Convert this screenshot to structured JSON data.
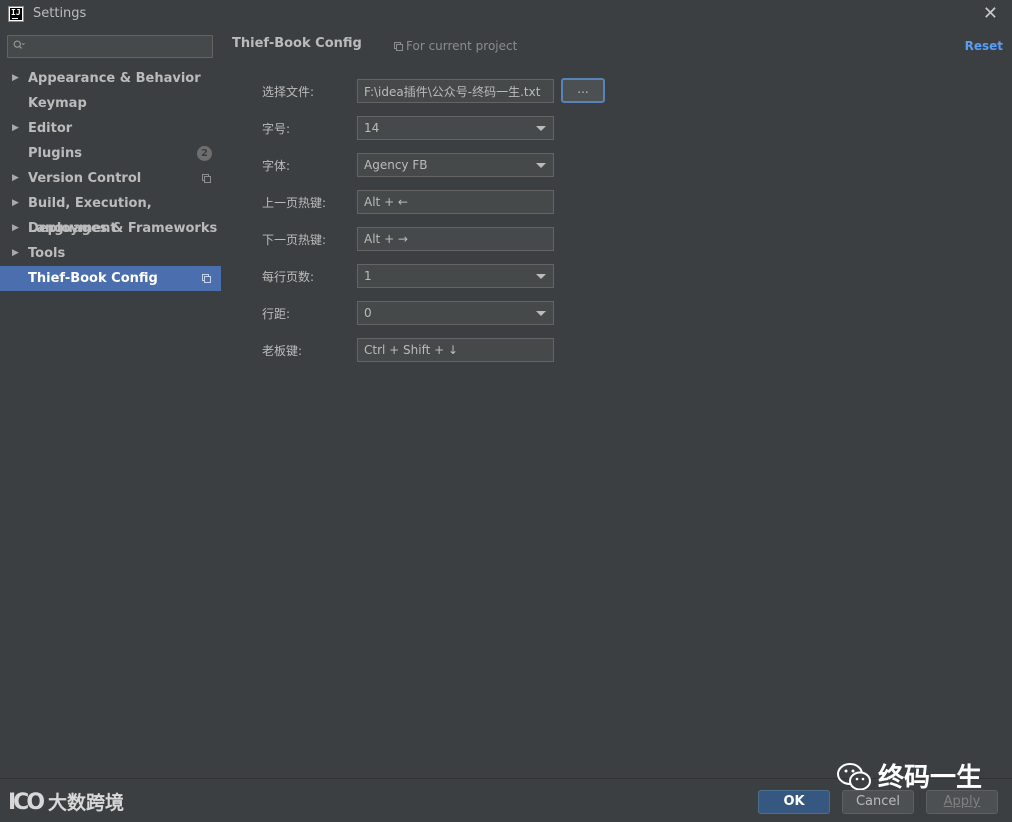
{
  "window": {
    "title": "Settings",
    "close_glyph": "✕",
    "app_icon_text": "IJ"
  },
  "sidebar": {
    "search_placeholder": "",
    "items": [
      {
        "label": "Appearance & Behavior",
        "arrow": "▶"
      },
      {
        "label": "Keymap"
      },
      {
        "label": "Editor",
        "arrow": "▶"
      },
      {
        "label": "Plugins",
        "badge": "2"
      },
      {
        "label": "Version Control",
        "arrow": "▶"
      },
      {
        "label": "Build, Execution, Deployment",
        "arrow": "▶"
      },
      {
        "label": "Languages & Frameworks",
        "arrow": "▶"
      },
      {
        "label": "Tools",
        "arrow": "▶"
      },
      {
        "label": "Thief-Book Config"
      }
    ]
  },
  "main": {
    "title": "Thief-Book Config",
    "scope_label": "For current project",
    "reset_label": "Reset",
    "form": {
      "file": {
        "label": "选择文件:",
        "value": "F:\\idea插件\\公众号-终码一生.txt",
        "browse_label": "..."
      },
      "font_size": {
        "label": "字号:",
        "value": "14"
      },
      "font_family": {
        "label": "字体:",
        "value": "Agency FB"
      },
      "prev_hotkey": {
        "label": "上一页热键:",
        "value": "Alt + ←"
      },
      "next_hotkey": {
        "label": "下一页热键:",
        "value": "Alt + →"
      },
      "lines_per_page": {
        "label": "每行页数:",
        "value": "1"
      },
      "line_spacing": {
        "label": "行距:",
        "value": "0"
      },
      "boss_key": {
        "label": "老板键:",
        "value": "Ctrl + Shift + ↓"
      }
    }
  },
  "footer": {
    "ok_label": "OK",
    "cancel_label": "Cancel",
    "apply_label": "Apply",
    "watermark_left_logo": "ICO",
    "watermark_left_text": "大数跨境",
    "watermark_right_text": "终码一生"
  },
  "colors": {
    "background": "#3c3f41",
    "selected": "#4b6eaf",
    "link": "#589df6",
    "primary_button": "#365880"
  }
}
